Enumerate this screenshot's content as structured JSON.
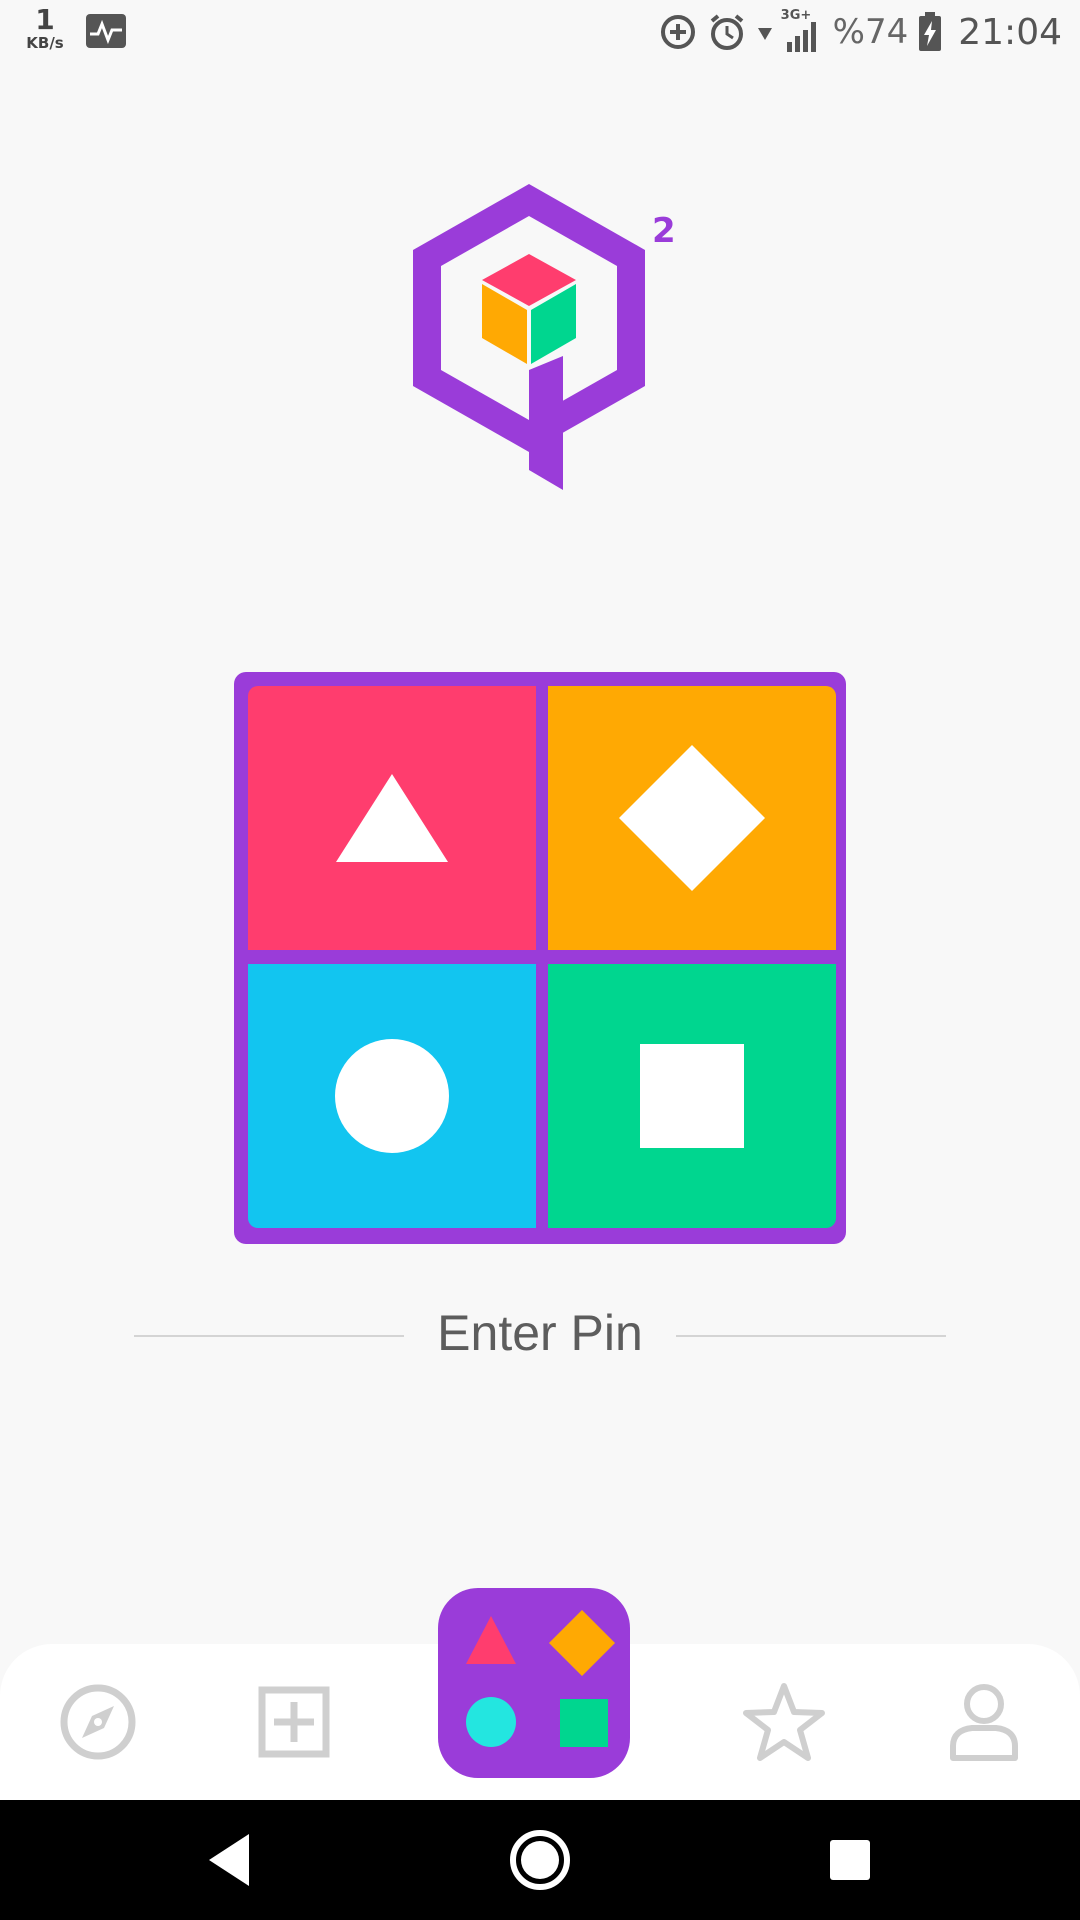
{
  "status_bar": {
    "net_speed_value": "1",
    "net_speed_unit": "KB/s",
    "network_type": "3G+",
    "battery_percent": "%74",
    "time": "21:04",
    "icons": [
      "activity-icon",
      "data-saver-icon",
      "alarm-icon",
      "wifi-icon",
      "signal-icon",
      "battery-charging-icon"
    ]
  },
  "logo": {
    "superscript": "2",
    "icon": "qube-cube-logo"
  },
  "pin_pad": {
    "tiles": [
      {
        "shape": "triangle",
        "color": "#ff3d6e"
      },
      {
        "shape": "diamond",
        "color": "#ffa903"
      },
      {
        "shape": "circle",
        "color": "#12c5f0"
      },
      {
        "shape": "square",
        "color": "#00d68f"
      }
    ],
    "border_color": "#9a3cd9"
  },
  "prompt": {
    "label": "Enter Pin"
  },
  "bottom_nav": {
    "items": [
      "compass-icon",
      "add-box-icon",
      "shapes-pin-icon",
      "star-icon",
      "person-icon"
    ],
    "center_color": "#9a3cd9"
  },
  "system_nav": {
    "items": [
      "back-icon",
      "home-icon",
      "recents-icon"
    ]
  }
}
